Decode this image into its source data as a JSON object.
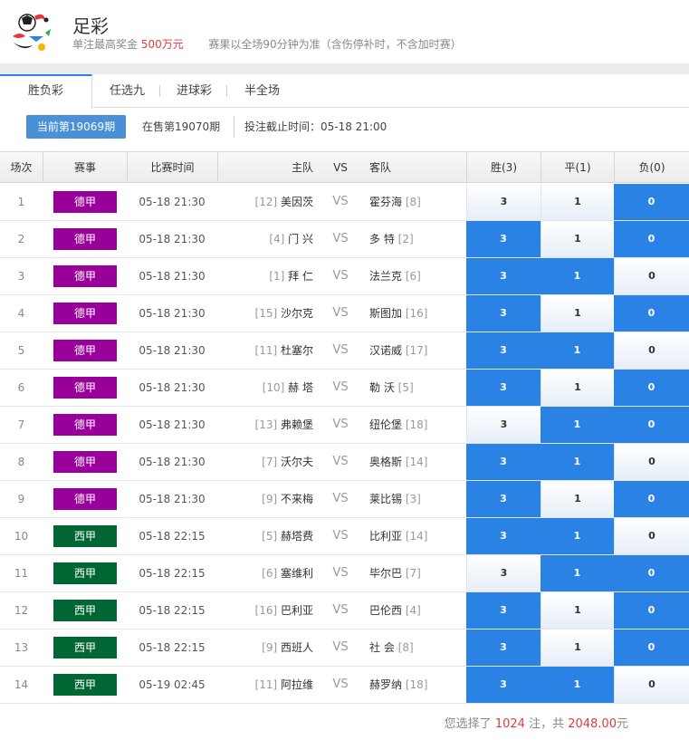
{
  "header": {
    "title": "足彩",
    "max_prize_prefix": "单注最高奖金",
    "max_prize_amount": "500万元",
    "rule_note": "赛果以全场90分钟为准（含伤停补时，不含加时赛）"
  },
  "tabs": [
    {
      "label": "胜负彩",
      "active": true
    },
    {
      "label": "任选九",
      "active": false
    },
    {
      "label": "进球彩",
      "active": false
    },
    {
      "label": "半全场",
      "active": false
    }
  ],
  "issues": {
    "current": "当前第19069期",
    "next": "在售第19070期",
    "deadline": "投注截止时间：05-18 21:00"
  },
  "columns": {
    "no": "场次",
    "league": "赛事",
    "time": "比赛时间",
    "home": "主队",
    "vs": "VS",
    "away": "客队",
    "win": "胜(3)",
    "draw": "平(1)",
    "lose": "负(0)"
  },
  "colors": {
    "德甲": "#990099",
    "西甲": "#006633",
    "selected": "#2a82e4"
  },
  "matches": [
    {
      "no": "1",
      "league": "德甲",
      "time": "05-18 21:30",
      "home_rank": "[12]",
      "home": "美因茨",
      "vs": "VS",
      "away": "霍芬海",
      "away_rank": "[8]",
      "sel": [
        false,
        false,
        true
      ]
    },
    {
      "no": "2",
      "league": "德甲",
      "time": "05-18 21:30",
      "home_rank": "[4]",
      "home": "门 兴",
      "vs": "VS",
      "away": "多 特",
      "away_rank": "[2]",
      "sel": [
        true,
        false,
        true
      ]
    },
    {
      "no": "3",
      "league": "德甲",
      "time": "05-18 21:30",
      "home_rank": "[1]",
      "home": "拜 仁",
      "vs": "VS",
      "away": "法兰克",
      "away_rank": "[6]",
      "sel": [
        true,
        true,
        false
      ]
    },
    {
      "no": "4",
      "league": "德甲",
      "time": "05-18 21:30",
      "home_rank": "[15]",
      "home": "沙尔克",
      "vs": "VS",
      "away": "斯图加",
      "away_rank": "[16]",
      "sel": [
        true,
        false,
        true
      ]
    },
    {
      "no": "5",
      "league": "德甲",
      "time": "05-18 21:30",
      "home_rank": "[11]",
      "home": "杜塞尔",
      "vs": "VS",
      "away": "汉诺威",
      "away_rank": "[17]",
      "sel": [
        true,
        true,
        false
      ]
    },
    {
      "no": "6",
      "league": "德甲",
      "time": "05-18 21:30",
      "home_rank": "[10]",
      "home": "赫 塔",
      "vs": "VS",
      "away": "勒 沃",
      "away_rank": "[5]",
      "sel": [
        true,
        false,
        true
      ]
    },
    {
      "no": "7",
      "league": "德甲",
      "time": "05-18 21:30",
      "home_rank": "[13]",
      "home": "弗赖堡",
      "vs": "VS",
      "away": "纽伦堡",
      "away_rank": "[18]",
      "sel": [
        false,
        true,
        true
      ]
    },
    {
      "no": "8",
      "league": "德甲",
      "time": "05-18 21:30",
      "home_rank": "[7]",
      "home": "沃尔夫",
      "vs": "VS",
      "away": "奥格斯",
      "away_rank": "[14]",
      "sel": [
        true,
        true,
        false
      ]
    },
    {
      "no": "9",
      "league": "德甲",
      "time": "05-18 21:30",
      "home_rank": "[9]",
      "home": "不来梅",
      "vs": "VS",
      "away": "莱比锡",
      "away_rank": "[3]",
      "sel": [
        true,
        false,
        true
      ]
    },
    {
      "no": "10",
      "league": "西甲",
      "time": "05-18 22:15",
      "home_rank": "[5]",
      "home": "赫塔费",
      "vs": "VS",
      "away": "比利亚",
      "away_rank": "[14]",
      "sel": [
        true,
        true,
        false
      ]
    },
    {
      "no": "11",
      "league": "西甲",
      "time": "05-18 22:15",
      "home_rank": "[6]",
      "home": "塞维利",
      "vs": "VS",
      "away": "毕尔巴",
      "away_rank": "[7]",
      "sel": [
        false,
        true,
        true
      ]
    },
    {
      "no": "12",
      "league": "西甲",
      "time": "05-18 22:15",
      "home_rank": "[16]",
      "home": "巴利亚",
      "vs": "VS",
      "away": "巴伦西",
      "away_rank": "[4]",
      "sel": [
        true,
        false,
        true
      ]
    },
    {
      "no": "13",
      "league": "西甲",
      "time": "05-18 22:15",
      "home_rank": "[9]",
      "home": "西班人",
      "vs": "VS",
      "away": "社 会",
      "away_rank": "[8]",
      "sel": [
        true,
        false,
        true
      ]
    },
    {
      "no": "14",
      "league": "西甲",
      "time": "05-19 02:45",
      "home_rank": "[11]",
      "home": "阿拉维",
      "vs": "VS",
      "away": "赫罗纳",
      "away_rank": "[18]",
      "sel": [
        true,
        true,
        false
      ]
    }
  ],
  "odds_labels": [
    "3",
    "1",
    "0"
  ],
  "footer": {
    "prefix": "您选择了",
    "count": "1024",
    "mid": "注，共",
    "amount": "2048.00",
    "suffix": "元"
  }
}
